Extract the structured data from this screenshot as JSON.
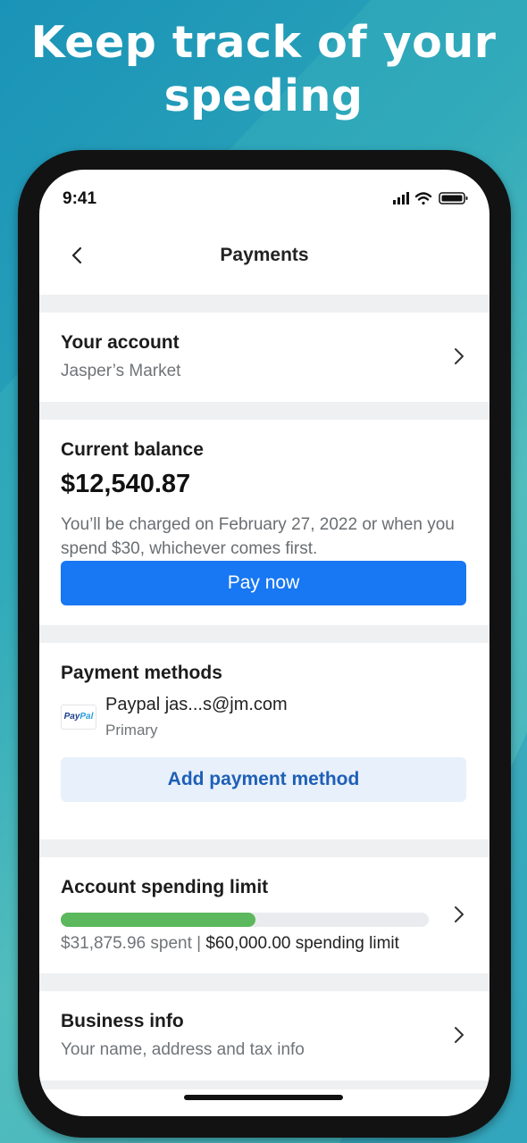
{
  "headline": {
    "line1": "Keep track of your",
    "line2": "speding"
  },
  "status": {
    "time": "9:41"
  },
  "nav": {
    "title": "Payments"
  },
  "account": {
    "title": "Your account",
    "name": "Jasper’s Market"
  },
  "balance": {
    "title": "Current balance",
    "amount": "$12,540.87",
    "description": "You’ll be charged on February 27, 2022 or when you spend $30, whichever comes first.",
    "pay_label": "Pay now"
  },
  "payment_methods": {
    "title": "Payment methods",
    "logo_part1": "Pay",
    "logo_part2": "Pal",
    "method_name": "Paypal jas...s@jm.com",
    "method_status": "Primary",
    "add_label": "Add payment method"
  },
  "spending_limit": {
    "title": "Account spending limit",
    "spent": "$31,875.96 spent",
    "separator": " | ",
    "limit": "$60,000.00 spending limit",
    "progress": 0.53,
    "bar_color": "#5cb85c"
  },
  "business": {
    "title": "Business info",
    "subtitle": "Your name, address and tax info"
  },
  "colors": {
    "accent": "#1877f2",
    "add_button_bg": "#e7f0fb",
    "add_button_text": "#1f5fb6"
  }
}
